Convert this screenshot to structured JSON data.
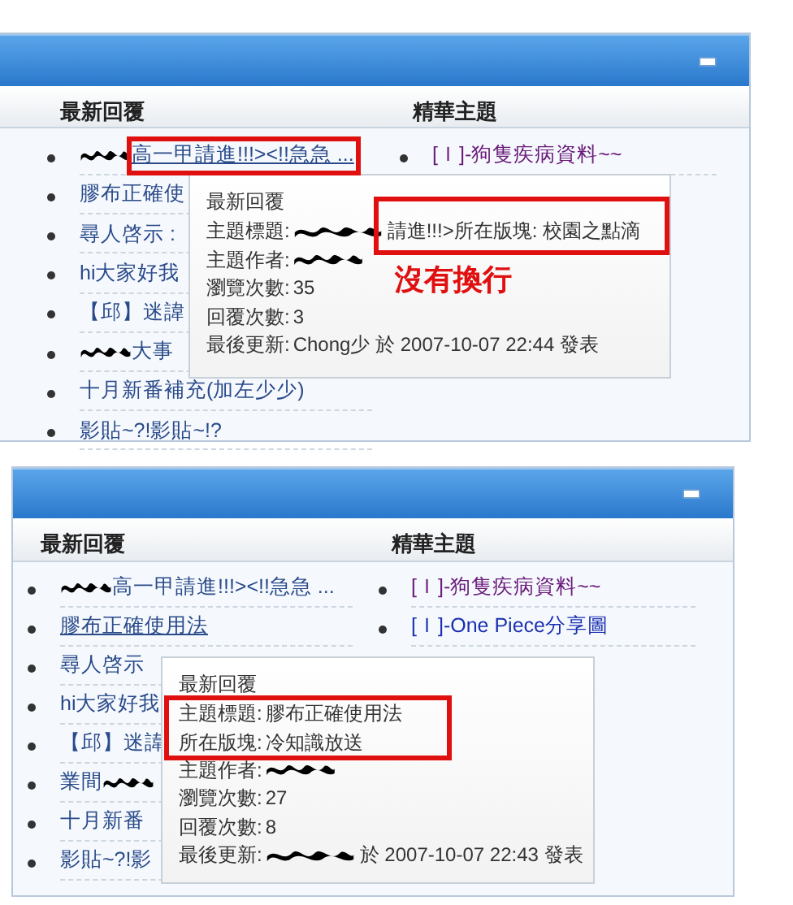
{
  "panels": [
    {
      "columns": [
        "最新回覆",
        "精華主題"
      ],
      "latest": [
        {
          "text": "高一甲請進!!!><!!急急 ...",
          "scribble": true,
          "hovered": true
        },
        {
          "text": "膠布正確使",
          "hovered": false
        },
        {
          "text": "尋人啓示 :",
          "hovered": false
        },
        {
          "text": "hi大家好我",
          "hovered": false
        },
        {
          "text": "【邱】迷諱",
          "hovered": false
        },
        {
          "text": "大事",
          "scribble": true,
          "hovered": false
        },
        {
          "text": "十月新番補充(加左少少)",
          "hovered": false
        },
        {
          "text": "影貼~?!影貼~!?",
          "hovered": false
        }
      ],
      "featured": [
        {
          "text": "[Ｉ]-狗隻疾病資料~~",
          "visited": true
        }
      ],
      "tooltip": {
        "heading": "最新回覆",
        "lines": [
          {
            "label": "主題標題:",
            "scribble": true,
            "value": "請進!!!>所在版塊: 校園之點滴"
          },
          {
            "label": "主題作者:",
            "scribble": true
          },
          {
            "label": "瀏覽次數:",
            "value": "35"
          },
          {
            "label": "回覆次數:",
            "value": "3"
          },
          {
            "label": "最後更新:",
            "value": "Chong少 於 2007-10-07 22:44 發表"
          }
        ]
      },
      "annotations": [
        {
          "kind": "box"
        },
        {
          "kind": "box"
        },
        {
          "kind": "note",
          "text": "沒有換行"
        }
      ]
    },
    {
      "columns": [
        "最新回覆",
        "精華主題"
      ],
      "latest": [
        {
          "text": "高一甲請進!!!><!!急急 ...",
          "scribble": true,
          "hovered": false
        },
        {
          "text": "膠布正確使用法",
          "hovered": true
        },
        {
          "text": "尋人啓示",
          "hovered": false
        },
        {
          "text": "hi大家好我",
          "hovered": false
        },
        {
          "text": "【邱】迷諱",
          "hovered": false
        },
        {
          "text": "業間",
          "trailing_scribble": true,
          "hovered": false
        },
        {
          "text": "十月新番",
          "hovered": false
        },
        {
          "text": "影貼~?!影",
          "hovered": false
        }
      ],
      "featured": [
        {
          "text": "[Ｉ]-狗隻疾病資料~~",
          "visited": true
        },
        {
          "text": "[Ｉ]-One Piece分享圖",
          "visited": false
        }
      ],
      "tooltip": {
        "heading": "最新回覆",
        "lines": [
          {
            "label": "主題標題:",
            "value": "膠布正確使用法"
          },
          {
            "label": "所在版塊:",
            "value": "冷知識放送"
          },
          {
            "label": "主題作者:",
            "scribble": true
          },
          {
            "label": "瀏覽次數:",
            "value": "27"
          },
          {
            "label": "回覆次數:",
            "value": "8"
          },
          {
            "label": "最後更新:",
            "scribble": true,
            "value": "於 2007-10-07 22:43 發表"
          }
        ]
      },
      "annotations": [
        {
          "kind": "box"
        }
      ]
    }
  ]
}
